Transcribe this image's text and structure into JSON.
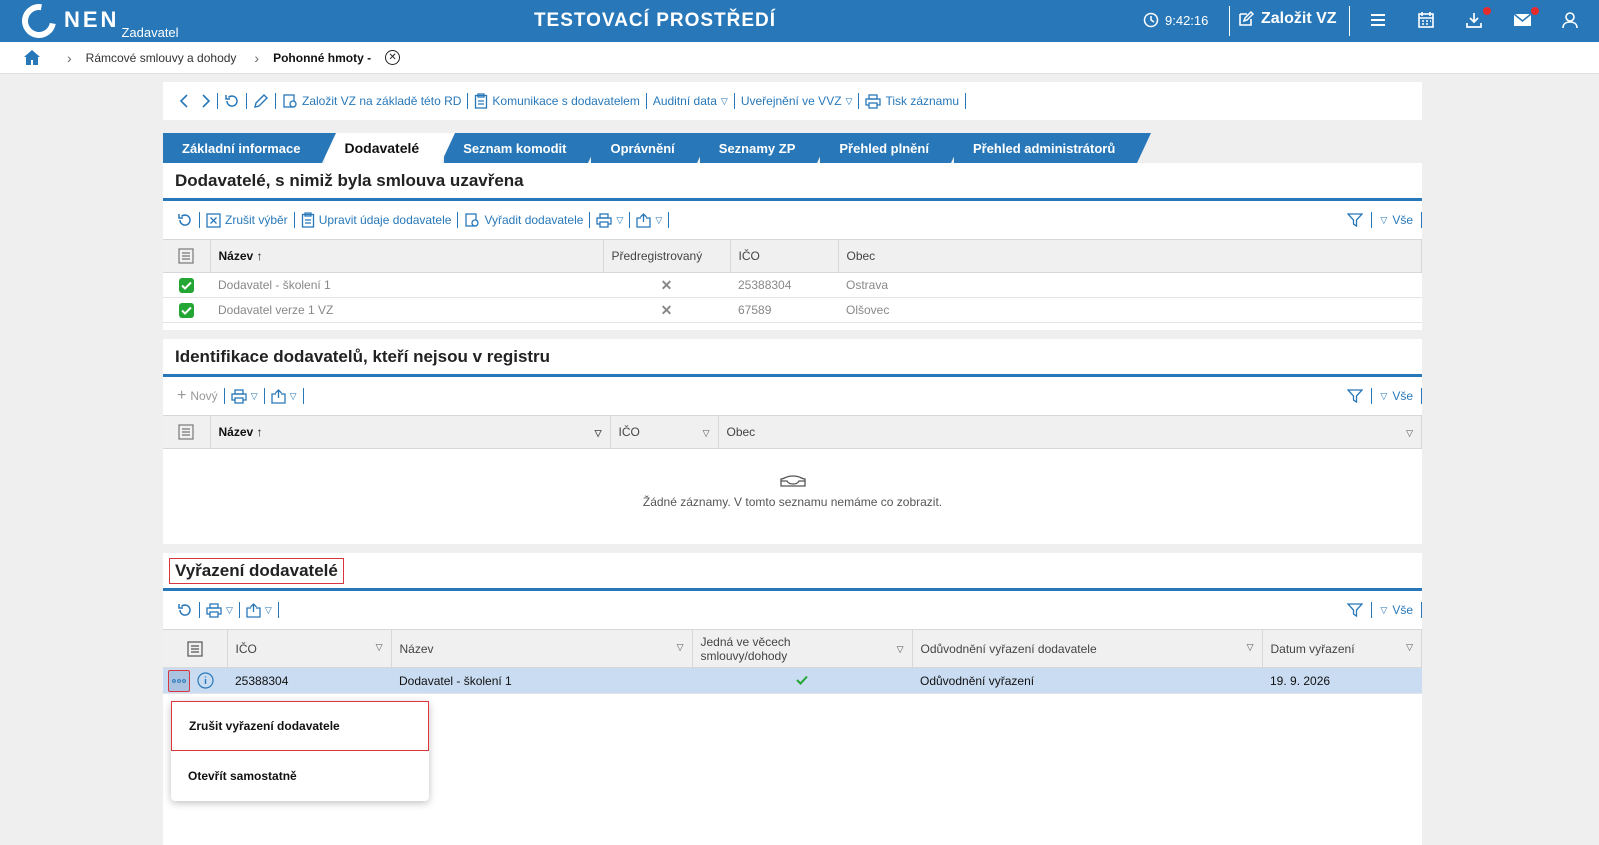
{
  "header": {
    "logo_text": "NEN",
    "logo_sub": "Zadavatel",
    "env_title": "TESTOVACÍ PROSTŘEDÍ",
    "time": "9:42:16",
    "create_vz": "Založit VZ",
    "icons": [
      "clock-icon",
      "edit-icon",
      "menu-icon",
      "calendar-icon",
      "download-icon",
      "mail-icon",
      "user-icon"
    ]
  },
  "breadcrumb": {
    "items": [
      "Rámcové smlouvy a dohody",
      "Pohonné hmoty -"
    ]
  },
  "actionbar": {
    "create_vz_rd": "Založit VZ na základě této RD",
    "communication": "Komunikace s dodavatelem",
    "audit": "Auditní data",
    "publish": "Uveřejnění ve VVZ",
    "print": "Tisk záznamu"
  },
  "tabs": [
    "Základní informace",
    "Dodavatelé",
    "Seznam komodit",
    "Oprávnění",
    "Seznamy ZP",
    "Přehled plnění",
    "Přehled administrátorů"
  ],
  "panel1": {
    "title": "Dodavatelé, s nimiž byla smlouva uzavřena",
    "toolbar": {
      "cancel_selection": "Zrušit výběr",
      "edit_supplier": "Upravit údaje dodavatele",
      "exclude_supplier": "Vyřadit dodavatele",
      "filter_all": "Vše"
    },
    "columns": [
      "Název",
      "Předregistrovaný",
      "IČO",
      "Obec"
    ],
    "rows": [
      {
        "name": "Dodavatel - školení 1",
        "ico": "25388304",
        "city": "Ostrava"
      },
      {
        "name": "Dodavatel verze 1 VZ",
        "ico": "67589",
        "city": "Olšovec"
      }
    ]
  },
  "panel2": {
    "title": "Identifikace dodavatelů, kteří nejsou v registru",
    "toolbar": {
      "new": "Nový",
      "filter_all": "Vše"
    },
    "columns": [
      "Název",
      "IČO",
      "Obec"
    ],
    "empty_text": "Žádné záznamy. V tomto seznamu nemáme co zobrazit."
  },
  "panel3": {
    "title": "Vyřazení dodavatelé",
    "toolbar": {
      "filter_all": "Vše"
    },
    "columns": [
      "IČO",
      "Název",
      "Jedná ve věcech smlouvy/dohody",
      "Odůvodnění vyřazení dodavatele",
      "Datum vyřazení"
    ],
    "rows": [
      {
        "ico": "25388304",
        "name": "Dodavatel - školení 1",
        "reason": "Odůvodnění vyřazení",
        "date": "19. 9. 2026"
      }
    ]
  },
  "context_menu": {
    "items": [
      "Zrušit vyřazení dodavatele",
      "Otevřít samostatně"
    ]
  },
  "colors": {
    "primary": "#2878b9",
    "highlight": "#d9363e",
    "selected_row": "#c9dcf1",
    "ok_green": "#23a633"
  }
}
